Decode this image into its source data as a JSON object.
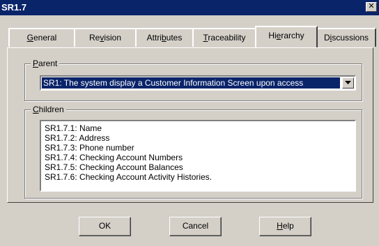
{
  "window": {
    "title": "SR1.7",
    "close_label": "✕"
  },
  "tabs": [
    {
      "pre": "",
      "key": "G",
      "post": "eneral",
      "active": false
    },
    {
      "pre": "Re",
      "key": "v",
      "post": "ision",
      "active": false
    },
    {
      "pre": "Attri",
      "key": "b",
      "post": "utes",
      "active": false
    },
    {
      "pre": "",
      "key": "T",
      "post": "raceability",
      "active": false
    },
    {
      "pre": "Hi",
      "key": "e",
      "post": "rarchy",
      "active": true
    },
    {
      "pre": "D",
      "key": "i",
      "post": "scussions",
      "active": false
    }
  ],
  "parent": {
    "label_pre": "",
    "label_key": "P",
    "label_post": "arent",
    "selected": "SR1: The system display a Customer Information Screen upon access"
  },
  "children": {
    "label_pre": "",
    "label_key": "C",
    "label_post": "hildren",
    "items": [
      "SR1.7.1: Name",
      "SR1.7.2: Address",
      "SR1.7.3: Phone number",
      "SR1.7.4: Checking Account Numbers",
      "SR1.7.5: Checking Account Balances",
      "SR1.7.6: Checking Account Activity Histories."
    ]
  },
  "buttons": {
    "ok": {
      "pre": "OK",
      "key": "",
      "post": ""
    },
    "cancel": {
      "pre": "Cancel",
      "key": "",
      "post": ""
    },
    "help": {
      "pre": "",
      "key": "H",
      "post": "elp"
    }
  },
  "colors": {
    "titlebar": "#0a246a",
    "face": "#d4d0c8",
    "selection": "#0a246a"
  }
}
